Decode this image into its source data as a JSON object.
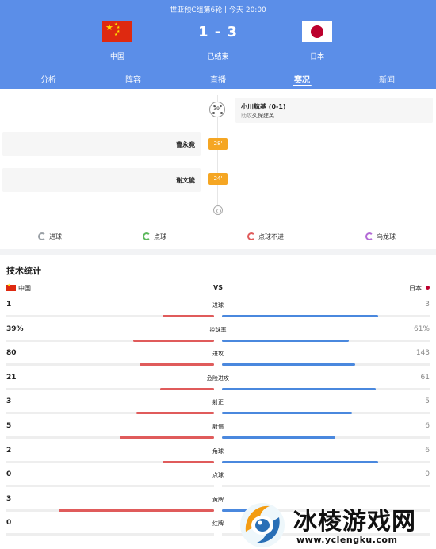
{
  "header": {
    "match_info": "世亚预C组第6轮 | 今天 20:00",
    "home": {
      "name": "中国",
      "flag_icon": "china-flag-icon"
    },
    "away": {
      "name": "日本",
      "flag_icon": "japan-flag-icon"
    },
    "score": "1 - 3",
    "status": "已结束",
    "colors": {
      "header_bg": "#5b8ee8",
      "home_bar": "#e05b5b",
      "away_bar": "#4a88de",
      "minute_badge": "#f5a623"
    }
  },
  "tabs": [
    {
      "label": "分析",
      "active": false
    },
    {
      "label": "阵容",
      "active": false
    },
    {
      "label": "直播",
      "active": false
    },
    {
      "label": "赛况",
      "active": true
    },
    {
      "label": "新闻",
      "active": false
    }
  ],
  "timeline": {
    "events": [
      {
        "side": "away",
        "minute": "39'",
        "type": "goal",
        "player": "小川航基 (0-1)",
        "assist_label": "助攻",
        "assist": "久保建英"
      },
      {
        "side": "home",
        "minute": "28'",
        "type": "yellow-card",
        "player": "曹永竟"
      },
      {
        "side": "home",
        "minute": "24'",
        "type": "yellow-card",
        "player": "谢文能"
      }
    ]
  },
  "legend": [
    {
      "label": "进球",
      "icon": "goal-icon",
      "color": "#9aa0a6"
    },
    {
      "label": "点球",
      "icon": "penalty-icon",
      "color": "#5cb85c"
    },
    {
      "label": "点球不进",
      "icon": "penalty-miss-icon",
      "color": "#e05b5b"
    },
    {
      "label": "乌龙球",
      "icon": "own-goal-icon",
      "color": "#b36bd6"
    }
  ],
  "stats": {
    "title": "技术统计",
    "home_label": "中国",
    "away_label": "日本",
    "vs": "VS",
    "rows": [
      {
        "name": "进球",
        "home": "1",
        "away": "3",
        "home_pct": 0.25,
        "away_pct": 0.75
      },
      {
        "name": "控球率",
        "home": "39%",
        "away": "61%",
        "home_pct": 0.39,
        "away_pct": 0.61
      },
      {
        "name": "进攻",
        "home": "80",
        "away": "143",
        "home_pct": 0.36,
        "away_pct": 0.64
      },
      {
        "name": "危险进攻",
        "home": "21",
        "away": "61",
        "home_pct": 0.26,
        "away_pct": 0.74
      },
      {
        "name": "射正",
        "home": "3",
        "away": "5",
        "home_pct": 0.375,
        "away_pct": 0.625
      },
      {
        "name": "射偏",
        "home": "5",
        "away": "6",
        "home_pct": 0.455,
        "away_pct": 0.545
      },
      {
        "name": "角球",
        "home": "2",
        "away": "6",
        "home_pct": 0.25,
        "away_pct": 0.75
      },
      {
        "name": "点球",
        "home": "0",
        "away": "0",
        "home_pct": 0,
        "away_pct": 0
      },
      {
        "name": "黄牌",
        "home": "3",
        "away": "",
        "home_pct": 0.75,
        "away_pct": 0.25
      },
      {
        "name": "红牌",
        "home": "0",
        "away": "",
        "home_pct": 0,
        "away_pct": 0
      }
    ]
  },
  "watermark": {
    "title": "冰棱游戏网",
    "url": "www.yclengku.com"
  }
}
